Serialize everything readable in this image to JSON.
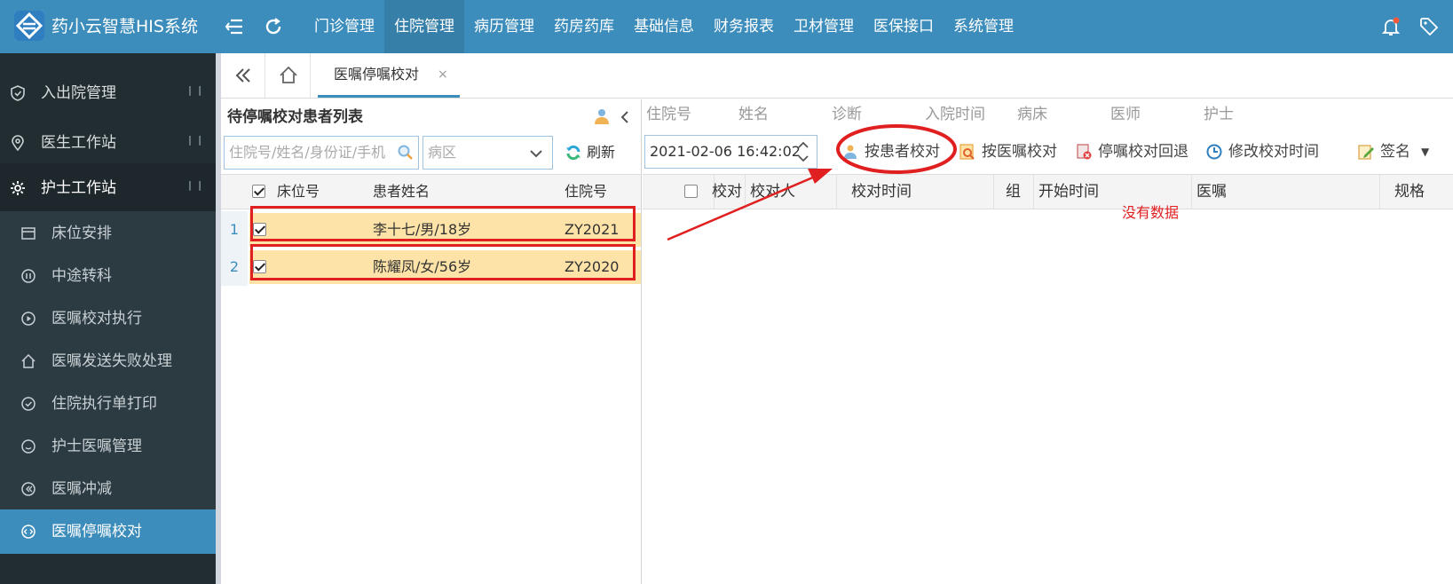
{
  "app": {
    "brand": "药小云智慧HIS系统"
  },
  "nav": [
    "门诊管理",
    "住院管理",
    "病历管理",
    "药房药库",
    "基础信息",
    "财务报表",
    "卫材管理",
    "医保接口",
    "系统管理"
  ],
  "sidebar": {
    "groups": [
      "入出院管理",
      "医生工作站",
      "护士工作站"
    ],
    "sub_items": [
      "床位安排",
      "中途转科",
      "医嘱校对执行",
      "医嘱发送失败处理",
      "住院执行单打印",
      "护士医嘱管理",
      "医嘱冲减",
      "医嘱停嘱校对"
    ]
  },
  "tabs": {
    "active_label": "医嘱停嘱校对",
    "close": "×"
  },
  "left_panel": {
    "title": "待停嘱校对患者列表",
    "search_placeholder": "住院号/姓名/身份证/手机",
    "ward_placeholder": "病区",
    "refresh_label": "刷新",
    "columns": [
      "床位号",
      "患者姓名",
      "住院号"
    ],
    "rows": [
      {
        "num": "1",
        "bed": "",
        "name": "李十七/男/18岁",
        "admission_no": "ZY2021"
      },
      {
        "num": "2",
        "bed": "",
        "name": "陈耀凤/女/56岁",
        "admission_no": "ZY2020"
      }
    ]
  },
  "right_panel": {
    "info_headers": [
      "住院号",
      "姓名",
      "诊断",
      "入院时间",
      "病床",
      "医师",
      "护士"
    ],
    "datetime_value": "2021-02-06 16:42:02",
    "toolbar": [
      "按患者校对",
      "按医嘱校对",
      "停嘱校对回退",
      "修改校对时间",
      "签名"
    ],
    "columns": [
      "校对",
      "校对人",
      "校对时间",
      "组",
      "开始时间",
      "医嘱",
      "规格"
    ],
    "empty_text": "没有数据"
  },
  "colors": {
    "primary": "#3c8dbc",
    "sidebar_bg": "#222d32",
    "highlight_row": "#fde3a7",
    "annotation_red": "#e02020"
  }
}
